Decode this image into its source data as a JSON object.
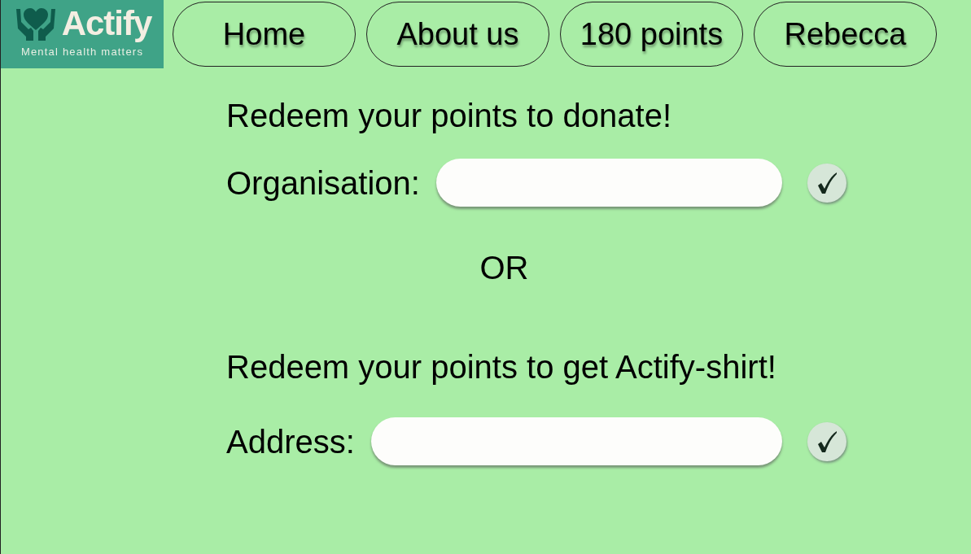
{
  "logo": {
    "name": "Actify",
    "tagline": "Mental health matters"
  },
  "nav": [
    {
      "label": "Home"
    },
    {
      "label": "About us"
    },
    {
      "label": "180 points"
    },
    {
      "label": "Rebecca"
    }
  ],
  "donate": {
    "heading": "Redeem your points to donate!",
    "field": {
      "label": "Organisation:"
    }
  },
  "separator": "OR",
  "shirt": {
    "heading": "Redeem your points to get Actify-shirt!",
    "field": {
      "label": "Address:"
    }
  }
}
